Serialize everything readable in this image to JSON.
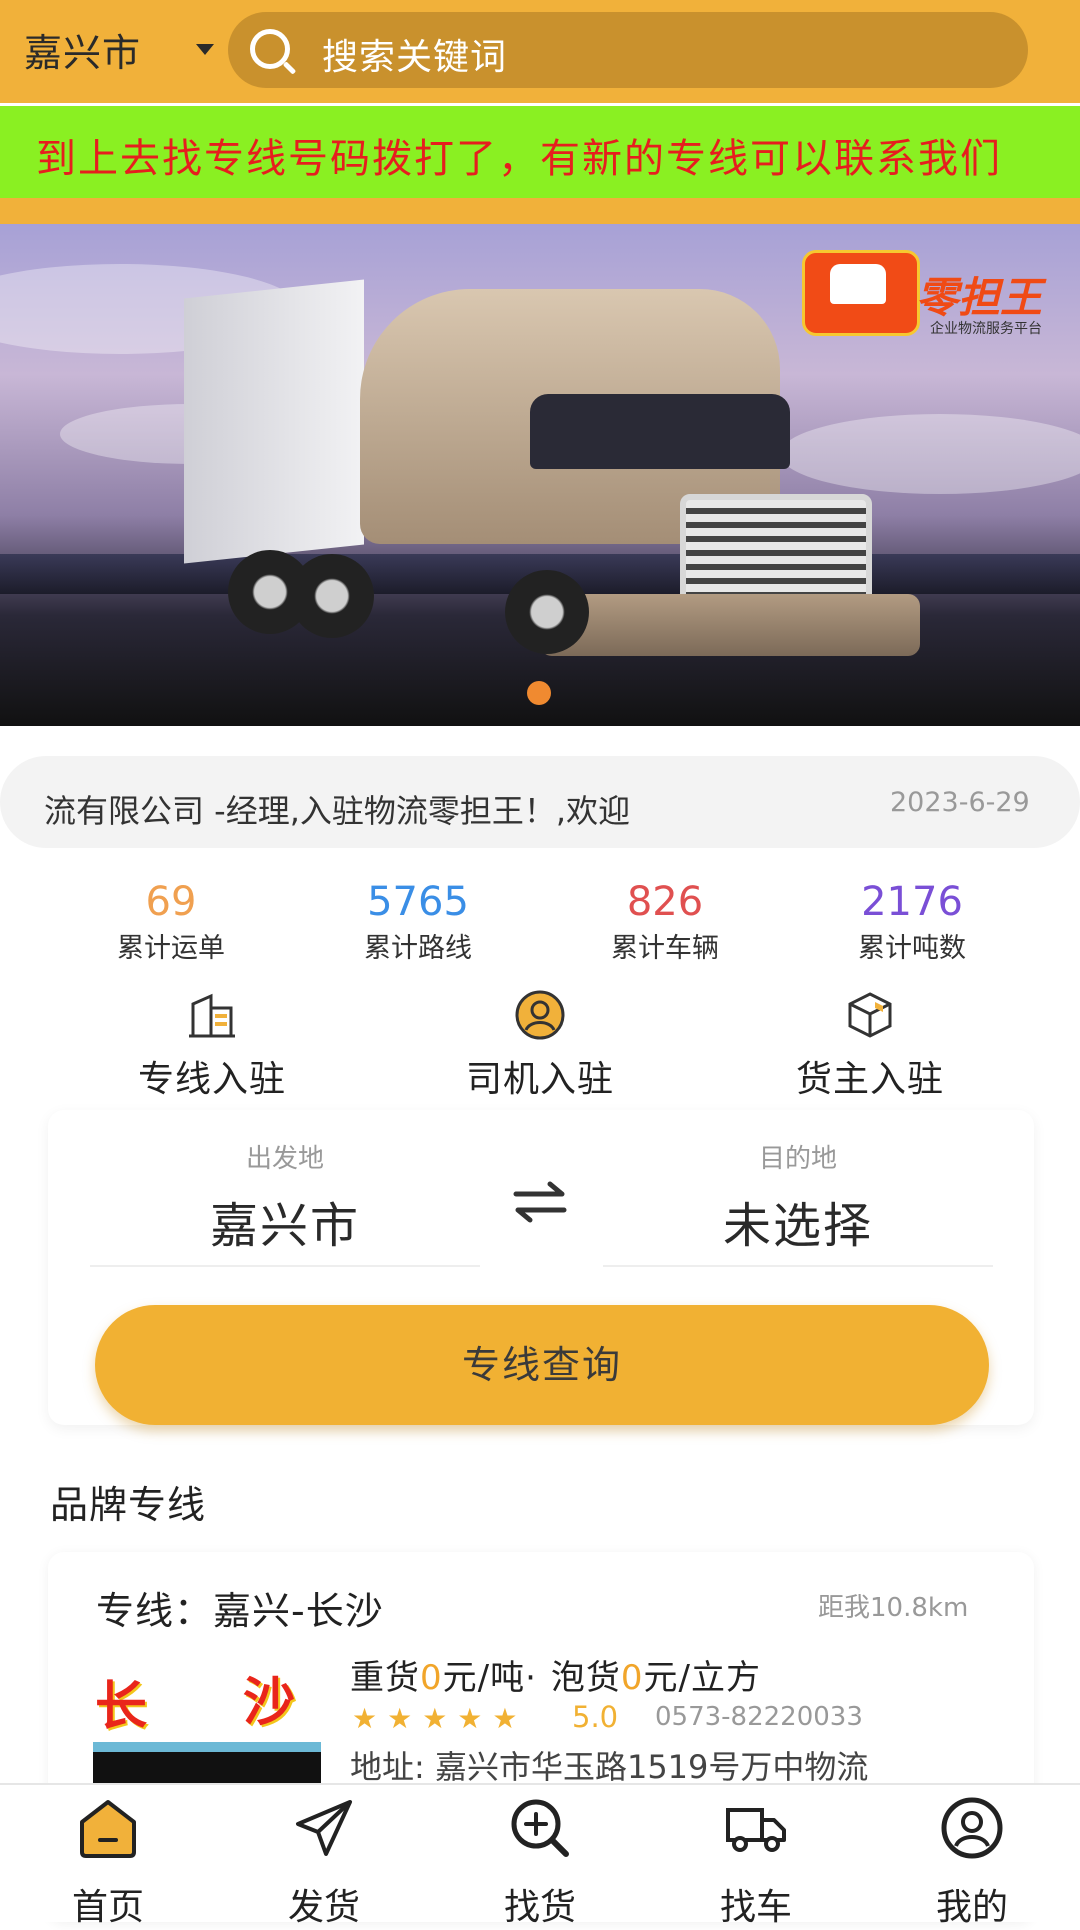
{
  "header": {
    "city": "嘉兴市",
    "search_placeholder": "搜索关键词"
  },
  "marquee": {
    "text": "到上去找专线号码拨打了，有新的专线可以联系我们"
  },
  "banner": {
    "brand": "零担王",
    "slogan": "企业物流服务平台",
    "slide_count": 1,
    "active_slide": 1
  },
  "news": {
    "text": "流有限公司 -经理,入驻物流零担王！,欢迎",
    "date": "2023-6-29"
  },
  "stats": [
    {
      "value": "69",
      "label": "累计运单",
      "color": "#f0a050"
    },
    {
      "value": "5765",
      "label": "累计路线",
      "color": "#3a8ee6"
    },
    {
      "value": "826",
      "label": "累计车辆",
      "color": "#e05050"
    },
    {
      "value": "2176",
      "label": "累计吨数",
      "color": "#7a4fd6"
    }
  ],
  "entries": [
    {
      "label": "专线入驻",
      "icon": "building-icon"
    },
    {
      "label": "司机入驻",
      "icon": "driver-avatar-icon"
    },
    {
      "label": "货主入驻",
      "icon": "package-box-icon"
    }
  ],
  "route": {
    "origin_caption": "出发地",
    "origin_value": "嘉兴市",
    "dest_caption": "目的地",
    "dest_value": "未选择",
    "query_button": "专线查询"
  },
  "brand_section": {
    "title": "品牌专线"
  },
  "line": {
    "title": "专线：嘉兴-长沙",
    "distance": "距我10.8km",
    "thumb_left": "长",
    "thumb_right": "沙",
    "heavy_label": "重货",
    "heavy_price": "0",
    "heavy_unit": "元/吨·",
    "light_label": "泡货",
    "light_price": "0",
    "light_unit": "元/立方",
    "stars": 5,
    "score": "5.0",
    "phone": "0573-82220033",
    "address": "地址: 嘉兴市华玉路1519号万中物流"
  },
  "nav": [
    {
      "label": "首页",
      "icon": "home-icon",
      "active": true
    },
    {
      "label": "发货",
      "icon": "send-icon",
      "active": false
    },
    {
      "label": "找货",
      "icon": "search-goods-icon",
      "active": false
    },
    {
      "label": "找车",
      "icon": "truck-icon",
      "active": false
    },
    {
      "label": "我的",
      "icon": "profile-icon",
      "active": false
    }
  ],
  "colors": {
    "primary": "#f1b13a",
    "marquee_bg": "#8af022",
    "marquee_text": "#e61e1e",
    "accent_price": "#f1a52a"
  }
}
